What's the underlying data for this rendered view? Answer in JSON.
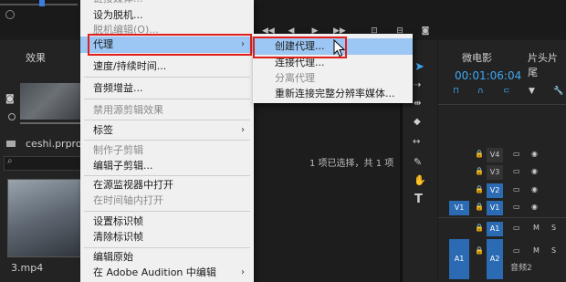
{
  "left_panel": {
    "tab_effects": "效果",
    "project_name": "ceshi.prproj",
    "clip_name": "3.mp4"
  },
  "program": {
    "selection_status": "1 项已选择，共 1 项"
  },
  "timeline": {
    "tab_name": "微电影",
    "tab_other": "片头片尾",
    "timecode": "00:01:06:04",
    "tracks": {
      "v4": "V4",
      "v3": "V3",
      "v2": "V2",
      "v1_src": "V1",
      "v1": "V1",
      "a1": "A1",
      "a1_src": "A1",
      "a2": "A2",
      "m": "M",
      "s": "S",
      "audio2_label": "音频2"
    }
  },
  "context_menu": {
    "top_cut": "链接媒体...",
    "set_offline": "设为脱机...",
    "edit_offline": "脱机编辑(O)...",
    "proxy": "代理",
    "speed_duration": "速度/持续时间...",
    "audio_gain": "音频增益...",
    "disable_master_effects": "禁用源剪辑效果",
    "label": "标签",
    "make_subclip": "制作子剪辑",
    "edit_subclip": "编辑子剪辑...",
    "open_in_source_monitor": "在源监视器中打开",
    "open_in_timeline": "在时间轴内打开",
    "set_poster_frame": "设置标识帧",
    "clear_poster_frame": "清除标识帧",
    "edit_original": "编辑原始",
    "edit_in_audition": "在 Adobe Audition 中编辑"
  },
  "submenu": {
    "create_proxy": "创建代理...",
    "attach_proxy": "连接代理...",
    "detach_proxy": "分离代理",
    "reconnect_full_res": "重新连接完整分辨率媒体..."
  },
  "colors": {
    "highlight": "#9cc6f3",
    "annotation_red": "#e0201c",
    "timecode_blue": "#3fa8f5",
    "track_blue": "#2b6bb3"
  }
}
